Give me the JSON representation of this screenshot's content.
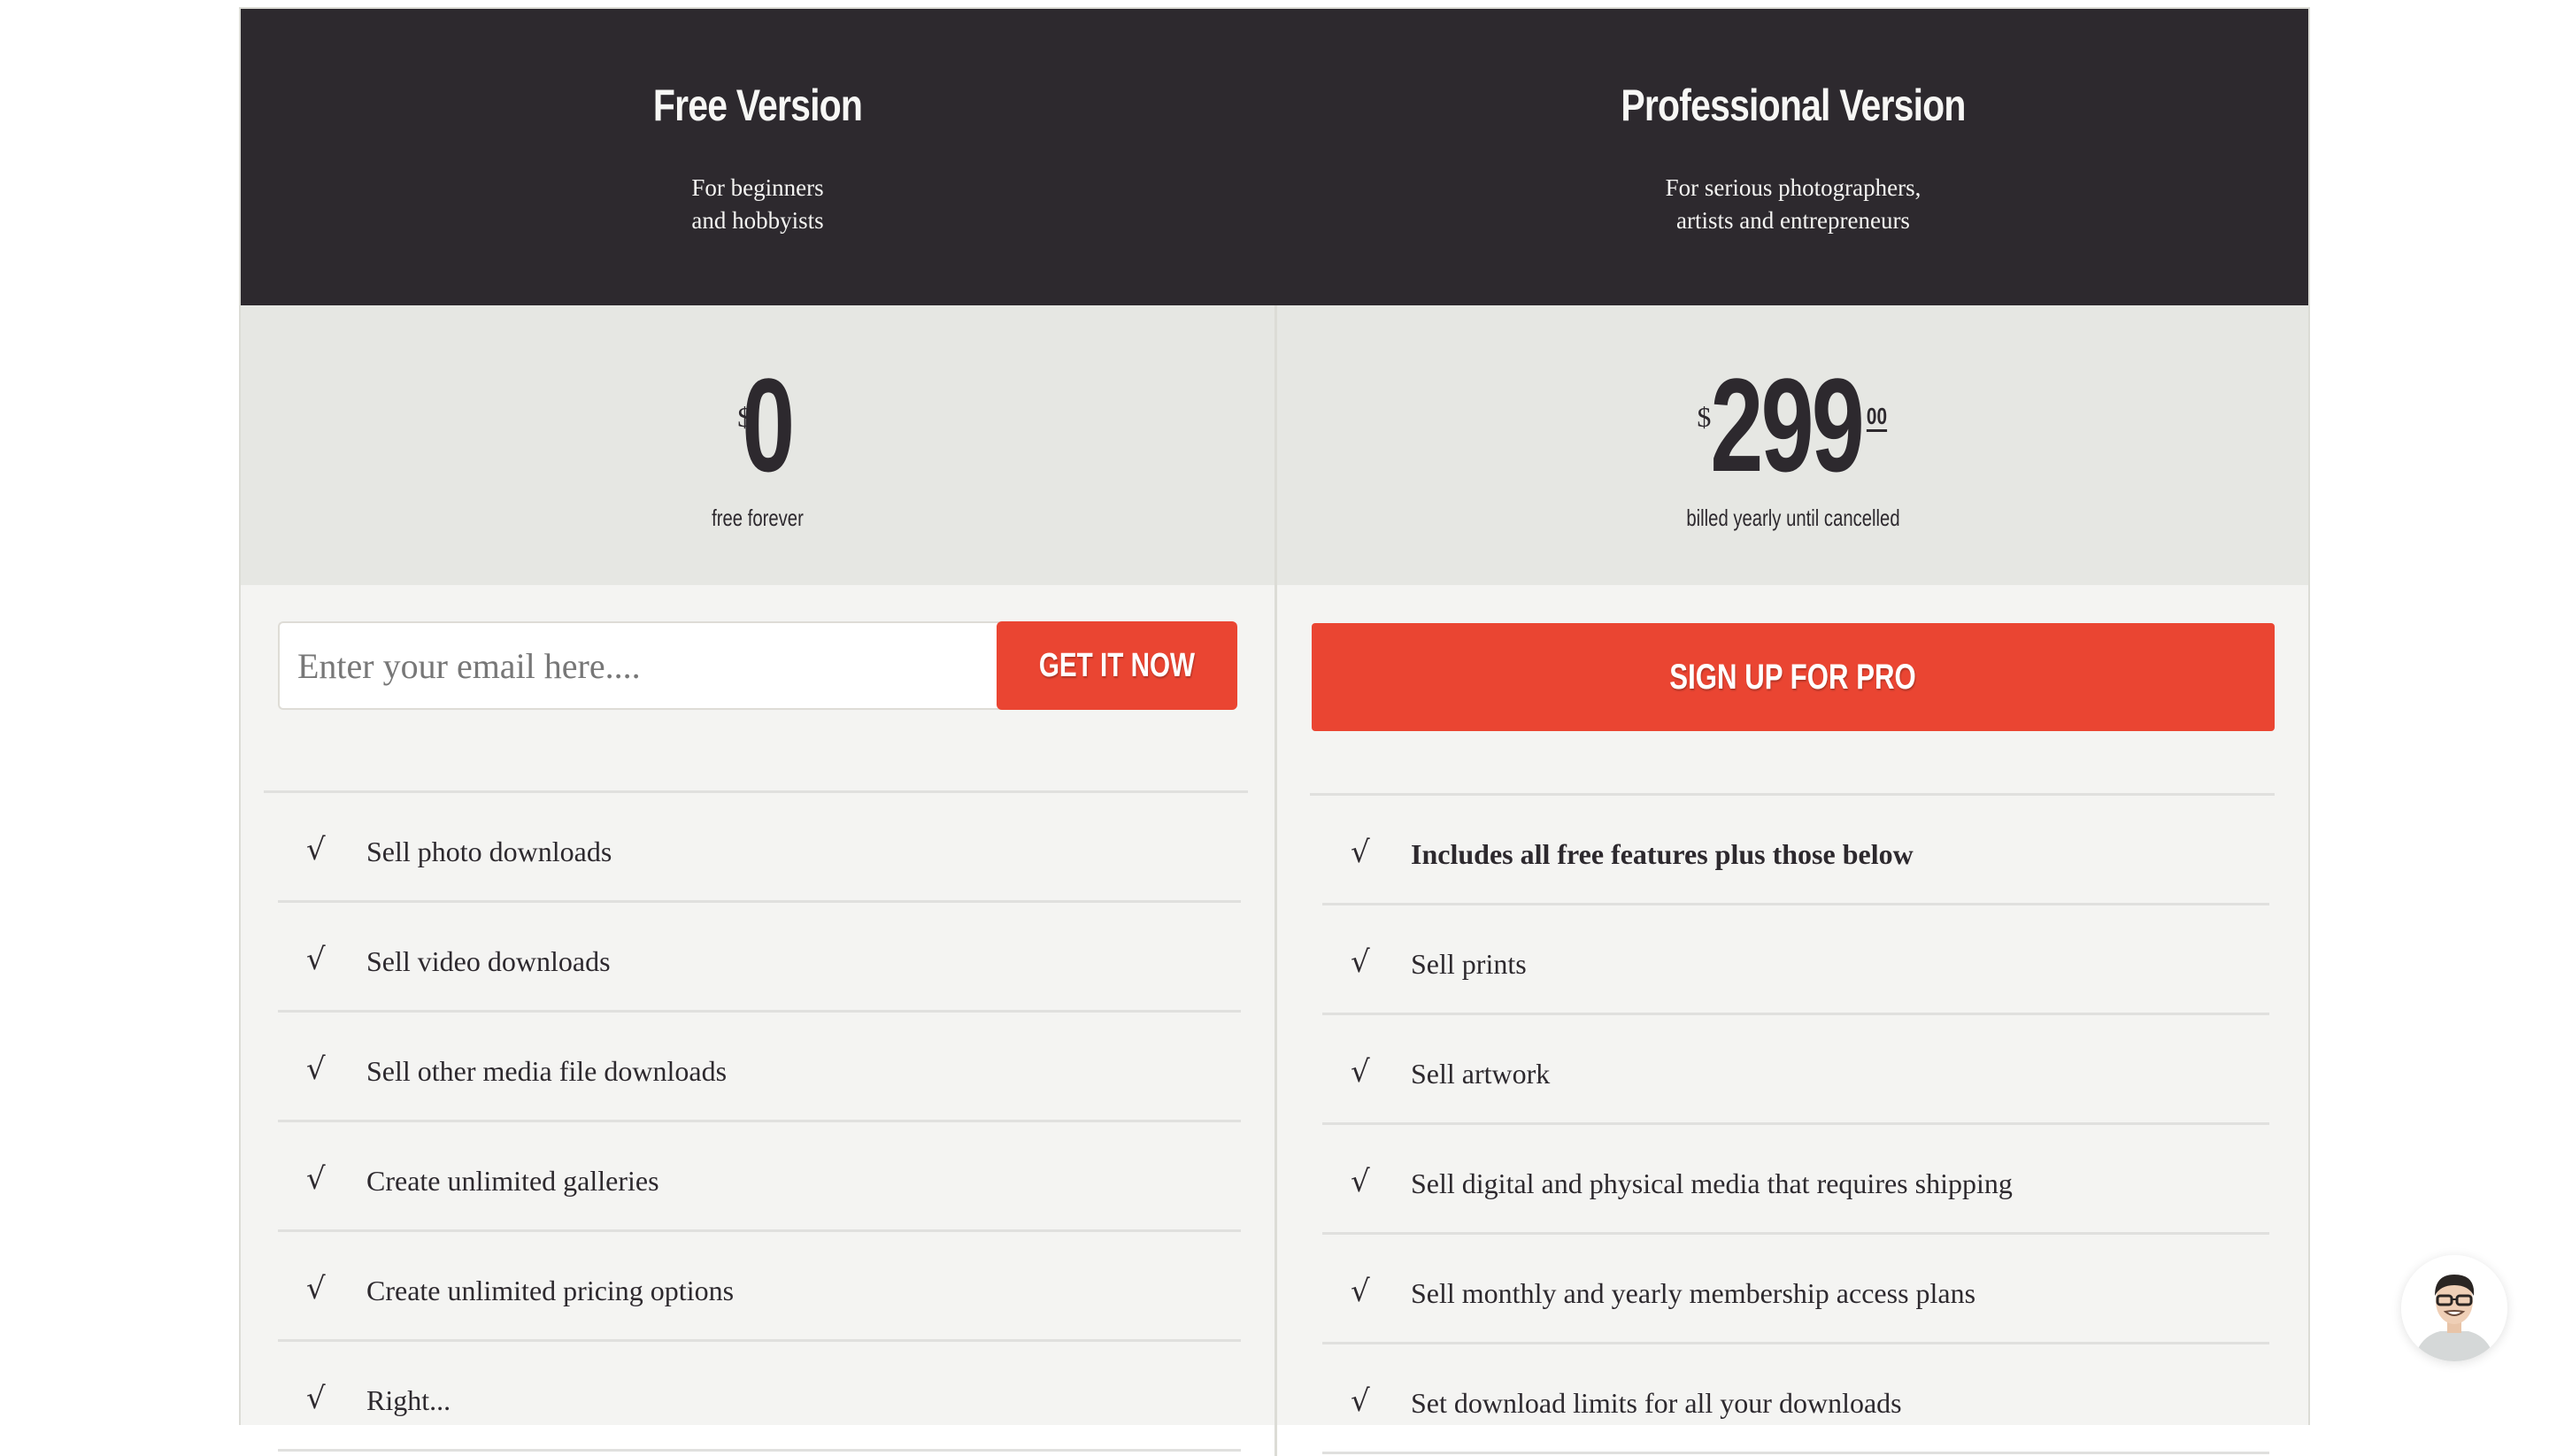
{
  "plans": [
    {
      "title": "Free Version",
      "subtitle_lines": [
        "For beginners",
        "and hobbyists"
      ],
      "currency": "$",
      "amount": "0",
      "cents": "",
      "price_note": "free forever",
      "email_placeholder": "Enter your email here....",
      "email_value": "",
      "cta_label": "GET IT NOW",
      "features": [
        {
          "text": "Sell photo downloads",
          "bold": false
        },
        {
          "text": "Sell video downloads",
          "bold": false
        },
        {
          "text": "Sell other media file downloads",
          "bold": false
        },
        {
          "text": "Create unlimited galleries",
          "bold": false
        },
        {
          "text": "Create unlimited pricing options",
          "bold": false
        },
        {
          "text": "Right...",
          "bold": false
        }
      ]
    },
    {
      "title": "Professional Version",
      "subtitle_lines": [
        "For serious photographers,",
        "artists and entrepreneurs"
      ],
      "currency": "$",
      "amount": "299",
      "cents": "00",
      "price_note": "billed yearly until cancelled",
      "cta_label": "SIGN UP FOR PRO",
      "features": [
        {
          "text": "Includes all free features plus those below",
          "bold": true
        },
        {
          "text": "Sell prints",
          "bold": false
        },
        {
          "text": "Sell artwork",
          "bold": false
        },
        {
          "text": "Sell digital and physical media that requires shipping",
          "bold": false
        },
        {
          "text": "Sell monthly and yearly membership access plans",
          "bold": false
        },
        {
          "text": "Set download limits for all your downloads",
          "bold": false
        }
      ]
    }
  ],
  "icons": {
    "check": "√"
  },
  "colors": {
    "header_bg": "#2d292e",
    "price_band_bg": "#e6e7e3",
    "body_bg": "#f4f4f2",
    "accent_red": "#ea4532",
    "text_dark": "#2d292e"
  },
  "chat_widget": {
    "avatar_alt": "support agent avatar"
  }
}
